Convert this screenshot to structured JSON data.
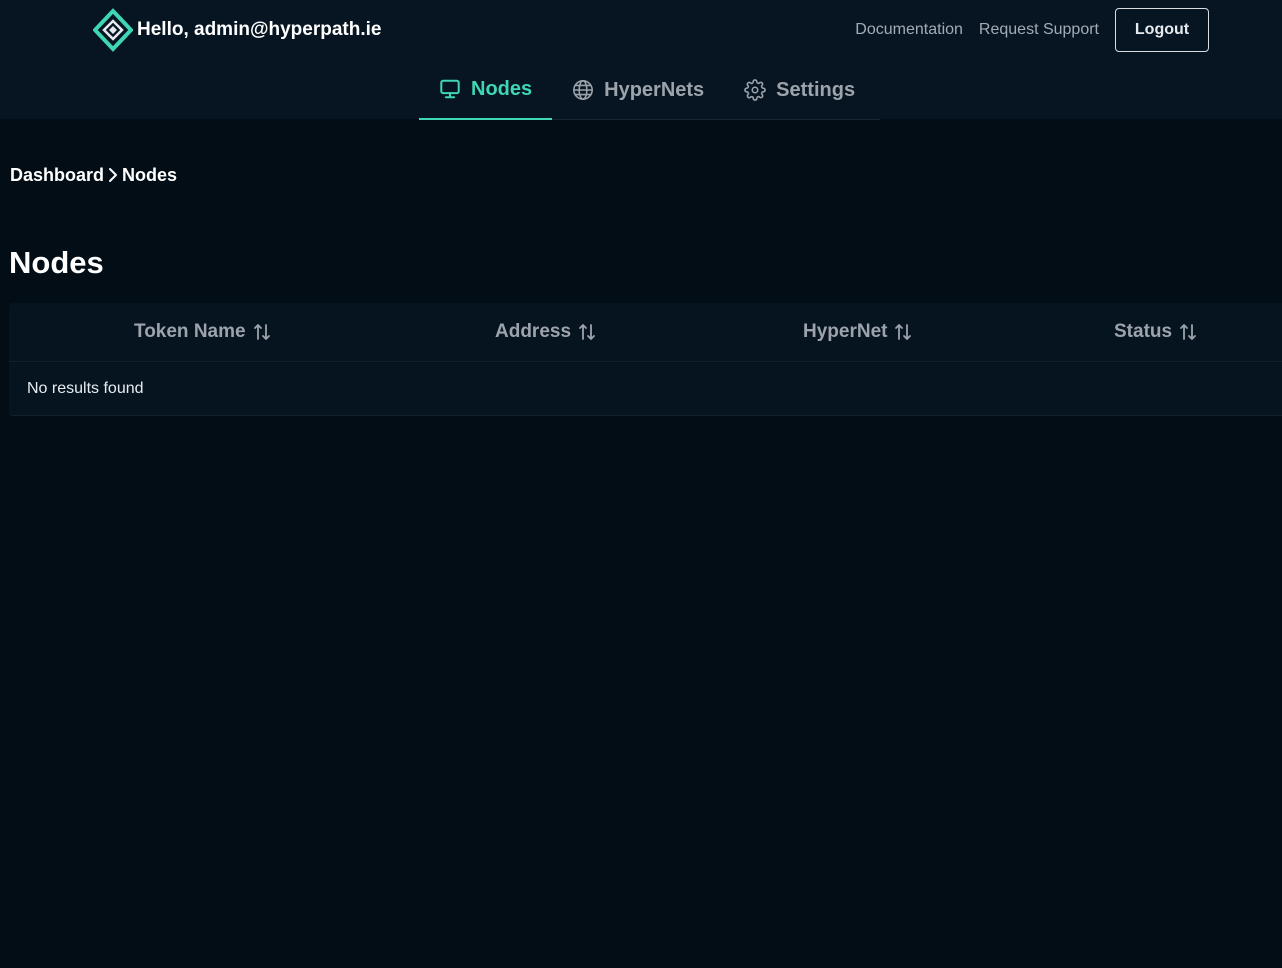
{
  "header": {
    "greeting": "Hello, admin@hyperpath.ie",
    "logo_icon": "hyperpath-logo-icon",
    "links": {
      "documentation": "Documentation",
      "support": "Request Support"
    },
    "logout_label": "Logout"
  },
  "tabs": [
    {
      "label": "Nodes",
      "icon": "monitor-icon",
      "active": true
    },
    {
      "label": "HyperNets",
      "icon": "globe-icon",
      "active": false
    },
    {
      "label": "Settings",
      "icon": "gear-icon",
      "active": false
    }
  ],
  "breadcrumb": {
    "parent": "Dashboard",
    "current": "Nodes",
    "separator_icon": "chevron-right-icon"
  },
  "page_title": "Nodes",
  "table": {
    "columns": [
      {
        "label": "Token Name",
        "icon": "sort-icon"
      },
      {
        "label": "Address",
        "icon": "sort-icon"
      },
      {
        "label": "HyperNet",
        "icon": "sort-icon"
      },
      {
        "label": "Status",
        "icon": "sort-icon"
      }
    ],
    "empty_message": "No results found"
  },
  "colors": {
    "accent": "#3ed6b4",
    "background": "#020d16",
    "header_background": "#071522",
    "muted_text": "#9ca3ab"
  }
}
